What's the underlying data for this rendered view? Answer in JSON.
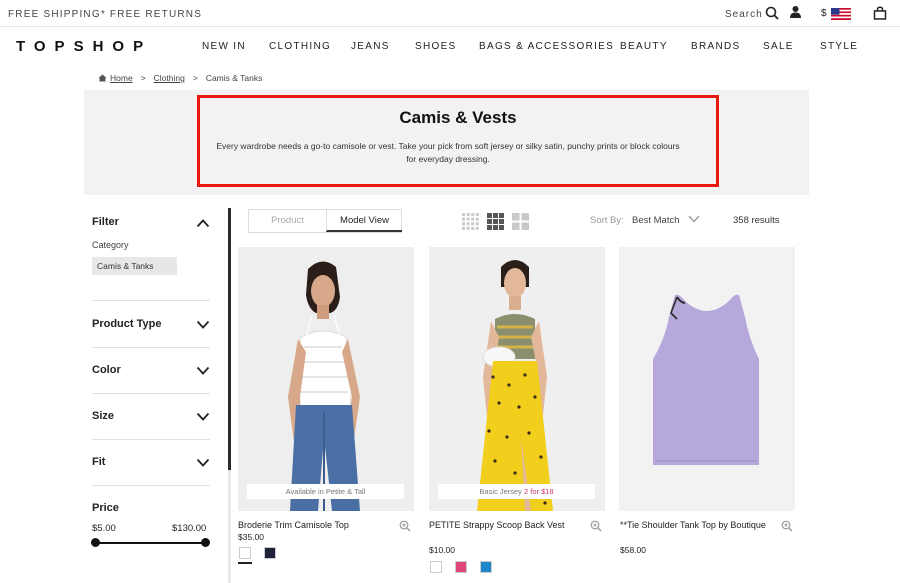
{
  "topbar": {
    "shipping_text": "FREE SHIPPING* FREE RETURNS",
    "search_label": "Search",
    "currency_symbol": "$"
  },
  "brand": {
    "logo_text": "TOPSHOP"
  },
  "nav": {
    "items": [
      "NEW IN",
      "CLOTHING",
      "JEANS",
      "SHOES",
      "BAGS & ACCESSORIES",
      "BEAUTY",
      "BRANDS",
      "SALE",
      "STYLE"
    ]
  },
  "breadcrumb": {
    "home": "Home",
    "separator": ">",
    "level1": "Clothing",
    "current": "Camis & Tanks"
  },
  "banner": {
    "title": "Camis & Vests",
    "description": "Every wardrobe needs a go-to camisole or vest. Take your pick from soft jersey or silky satin, punchy prints or block colours for everyday dressing.",
    "highlight_color": "#e8170f"
  },
  "filter": {
    "heading": "Filter",
    "category_label": "Category",
    "selected_category": "Camis & Tanks",
    "facets": [
      "Product Type",
      "Color",
      "Size",
      "Fit"
    ],
    "price": {
      "label": "Price",
      "min": "$5.00",
      "max": "$130.00"
    }
  },
  "toolbar": {
    "view_product": "Product",
    "view_model": "Model View",
    "sort_label": "Sort By:",
    "sort_value": "Best Match",
    "results": "358 results"
  },
  "products": [
    {
      "name": "Broderie Trim Camisole Top",
      "price": "$35.00",
      "badge": "Available in Petite & Tall",
      "swatches": [
        "#ffffff",
        "#1f2238"
      ]
    },
    {
      "name": "PETITE Strappy Scoop Back Vest",
      "price": "$10.00",
      "badge_prefix": "Basic Jersey",
      "badge_offer": "2 for $18",
      "swatches": [
        "#ffffff",
        "#e0457b",
        "#1f86c9"
      ]
    },
    {
      "name": "**Tie Shoulder Tank Top by Boutique",
      "price": "$58.00"
    }
  ]
}
